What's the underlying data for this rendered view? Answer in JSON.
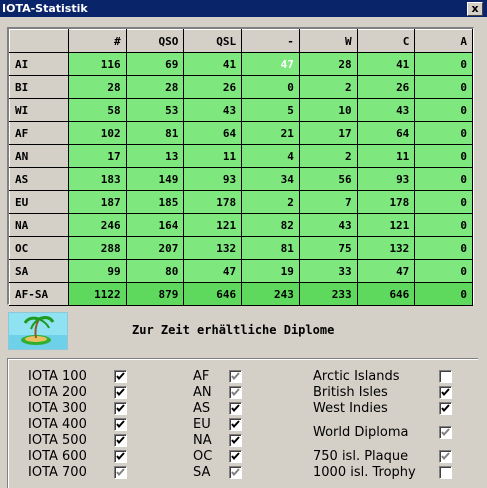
{
  "window": {
    "title": "IOTA-Statistik",
    "close_label": "x"
  },
  "table": {
    "columns": [
      "#",
      "QSO",
      "QSL",
      "-",
      "W",
      "C",
      "A"
    ],
    "rows": [
      {
        "label": "AI",
        "values": [
          "116",
          "69",
          "41",
          "47",
          "28",
          "41",
          "0"
        ]
      },
      {
        "label": "BI",
        "values": [
          "28",
          "28",
          "26",
          "0",
          "2",
          "26",
          "0"
        ]
      },
      {
        "label": "WI",
        "values": [
          "58",
          "53",
          "43",
          "5",
          "10",
          "43",
          "0"
        ]
      },
      {
        "label": "AF",
        "values": [
          "102",
          "81",
          "64",
          "21",
          "17",
          "64",
          "0"
        ]
      },
      {
        "label": "AN",
        "values": [
          "17",
          "13",
          "11",
          "4",
          "2",
          "11",
          "0"
        ]
      },
      {
        "label": "AS",
        "values": [
          "183",
          "149",
          "93",
          "34",
          "56",
          "93",
          "0"
        ]
      },
      {
        "label": "EU",
        "values": [
          "187",
          "185",
          "178",
          "2",
          "7",
          "178",
          "0"
        ]
      },
      {
        "label": "NA",
        "values": [
          "246",
          "164",
          "121",
          "82",
          "43",
          "121",
          "0"
        ]
      },
      {
        "label": "OC",
        "values": [
          "288",
          "207",
          "132",
          "81",
          "75",
          "132",
          "0"
        ]
      },
      {
        "label": "SA",
        "values": [
          "99",
          "80",
          "47",
          "19",
          "33",
          "47",
          "0"
        ]
      },
      {
        "label": "AF-SA",
        "values": [
          "1122",
          "879",
          "646",
          "243",
          "233",
          "646",
          "0"
        ]
      }
    ],
    "cell_color": "#7ee87e",
    "selected_row_color": "#5ed95e"
  },
  "diplome": {
    "title": "Zur Zeit erhältliche Diplome",
    "col1": [
      {
        "label": "IOTA 100",
        "checked": true,
        "enabled": true
      },
      {
        "label": "IOTA 200",
        "checked": true,
        "enabled": true
      },
      {
        "label": "IOTA 300",
        "checked": true,
        "enabled": true
      },
      {
        "label": "IOTA 400",
        "checked": true,
        "enabled": true
      },
      {
        "label": "IOTA 500",
        "checked": true,
        "enabled": true
      },
      {
        "label": "IOTA 600",
        "checked": true,
        "enabled": true
      },
      {
        "label": "IOTA 700",
        "checked": true,
        "enabled": false
      }
    ],
    "col2": [
      {
        "label": "AF",
        "checked": true,
        "enabled": false
      },
      {
        "label": "AN",
        "checked": true,
        "enabled": false
      },
      {
        "label": "AS",
        "checked": true,
        "enabled": true
      },
      {
        "label": "EU",
        "checked": true,
        "enabled": true
      },
      {
        "label": "NA",
        "checked": true,
        "enabled": true
      },
      {
        "label": "OC",
        "checked": true,
        "enabled": true
      },
      {
        "label": "SA",
        "checked": true,
        "enabled": false
      }
    ],
    "col3": [
      {
        "label": "Arctic Islands",
        "checked": false,
        "enabled": true
      },
      {
        "label": "British Isles",
        "checked": true,
        "enabled": true
      },
      {
        "label": "West Indies",
        "checked": true,
        "enabled": true
      },
      {
        "label": "World Diploma",
        "checked": true,
        "enabled": false
      },
      {
        "label": "750 isl. Plaque",
        "checked": true,
        "enabled": false
      },
      {
        "label": "1000 isl. Trophy",
        "checked": false,
        "enabled": true
      }
    ]
  }
}
